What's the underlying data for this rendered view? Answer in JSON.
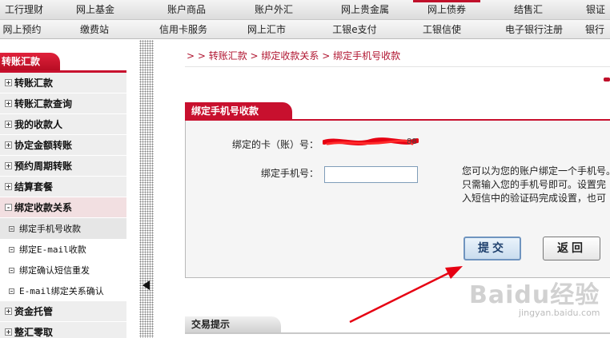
{
  "nav": {
    "row1": [
      "工行理财",
      "网上基金",
      "账户商品",
      "账户外汇",
      "网上贵金属",
      "网上债券",
      "结售汇",
      "银证"
    ],
    "row2": [
      "网上预约",
      "缴费站",
      "信用卡服务",
      "网上汇市",
      "工银e支付",
      "工银信使",
      "电子银行注册",
      "银行"
    ]
  },
  "sidebar": {
    "title": "转账汇款",
    "items": [
      {
        "label": "转账汇款"
      },
      {
        "label": "转账汇款查询"
      },
      {
        "label": "我的收款人"
      },
      {
        "label": "协定金额转账"
      },
      {
        "label": "预约周期转账"
      },
      {
        "label": "结算套餐"
      },
      {
        "label": "绑定收款关系"
      },
      {
        "label": "资金托管"
      },
      {
        "label": "整汇零取"
      }
    ],
    "subitems": [
      {
        "label": "绑定手机号收款"
      },
      {
        "label": "绑定E-mail收款"
      },
      {
        "label": "绑定确认短信重发"
      },
      {
        "label": "E-mail绑定关系确认"
      }
    ]
  },
  "breadcrumb": "> > 转账汇款 > 绑定收款关系 > 绑定手机号收款",
  "panel": {
    "title": "绑定手机号收款",
    "card_label": "绑定的卡（账）号：",
    "card_tail": "88",
    "phone_label": "绑定手机号：",
    "phone_value": "",
    "hint_lines": [
      "您可以为您的账户绑定一个手机号。",
      "只需输入您的手机号即可。设置完",
      "入短信中的验证码完成设置，也可"
    ],
    "submit_label": "提交",
    "back_label": "返回"
  },
  "tips": {
    "title": "交易提示"
  },
  "watermark": {
    "brand": "Baidu经验",
    "url": "jingyan.baidu.com"
  },
  "colors": {
    "brand_red": "#c8102e",
    "annotation_red": "#e60012",
    "submit_border": "#6f94bf"
  }
}
